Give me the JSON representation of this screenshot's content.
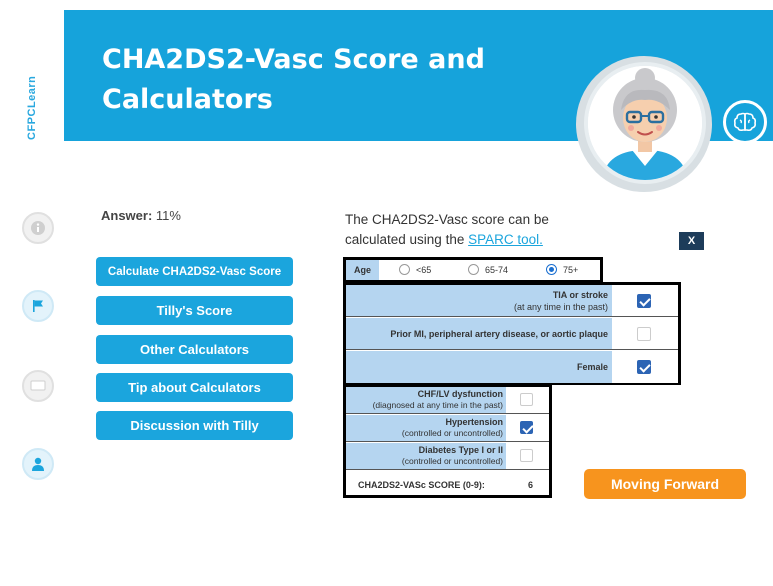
{
  "brand": "CFPCLearn",
  "header": {
    "title_line1": "CHA2DS2-Vasc Score and",
    "title_line2": "Calculators"
  },
  "rail": {
    "icons": [
      "info-icon",
      "flag-icon",
      "chat-icon",
      "user-icon"
    ]
  },
  "answer": {
    "label": "Answer:",
    "value": "11%"
  },
  "menu": {
    "items": [
      "Calculate CHA2DS2-Vasc Score",
      "Tilly's Score",
      "Other Calculators",
      "Tip about Calculators",
      "Discussion with Tilly"
    ]
  },
  "description": {
    "text": "The CHA2DS2-Vasc score can be calculated using the",
    "link": "SPARC tool."
  },
  "close_label": "X",
  "calculator": {
    "age": {
      "label": "Age",
      "options": [
        "<65",
        "65-74",
        "75+"
      ],
      "selected": "75+"
    },
    "risk_rows": [
      {
        "label": "TIA or stroke",
        "sub": "(at any time in the past)",
        "checked": true
      },
      {
        "label": "Prior MI, peripheral artery disease, or aortic plaque",
        "sub": "",
        "checked": false
      },
      {
        "label": "Female",
        "sub": "",
        "checked": true
      }
    ],
    "condition_rows": [
      {
        "label": "CHF/LV dysfunction",
        "sub": "(diagnosed at any time in the past)",
        "checked": false
      },
      {
        "label": "Hypertension",
        "sub": "(controlled or uncontrolled)",
        "checked": true
      },
      {
        "label": "Diabetes Type I or II",
        "sub": "(controlled or uncontrolled)",
        "checked": false
      }
    ],
    "score_label": "CHA2DS2-VASc SCORE (0-9):",
    "score_value": "6"
  },
  "forward_label": "Moving Forward",
  "colors": {
    "banner": "#16a3db",
    "button": "#1ba5dd",
    "forward": "#f7941e",
    "table_label": "#b5d5f0",
    "close": "#1d3c5a"
  }
}
